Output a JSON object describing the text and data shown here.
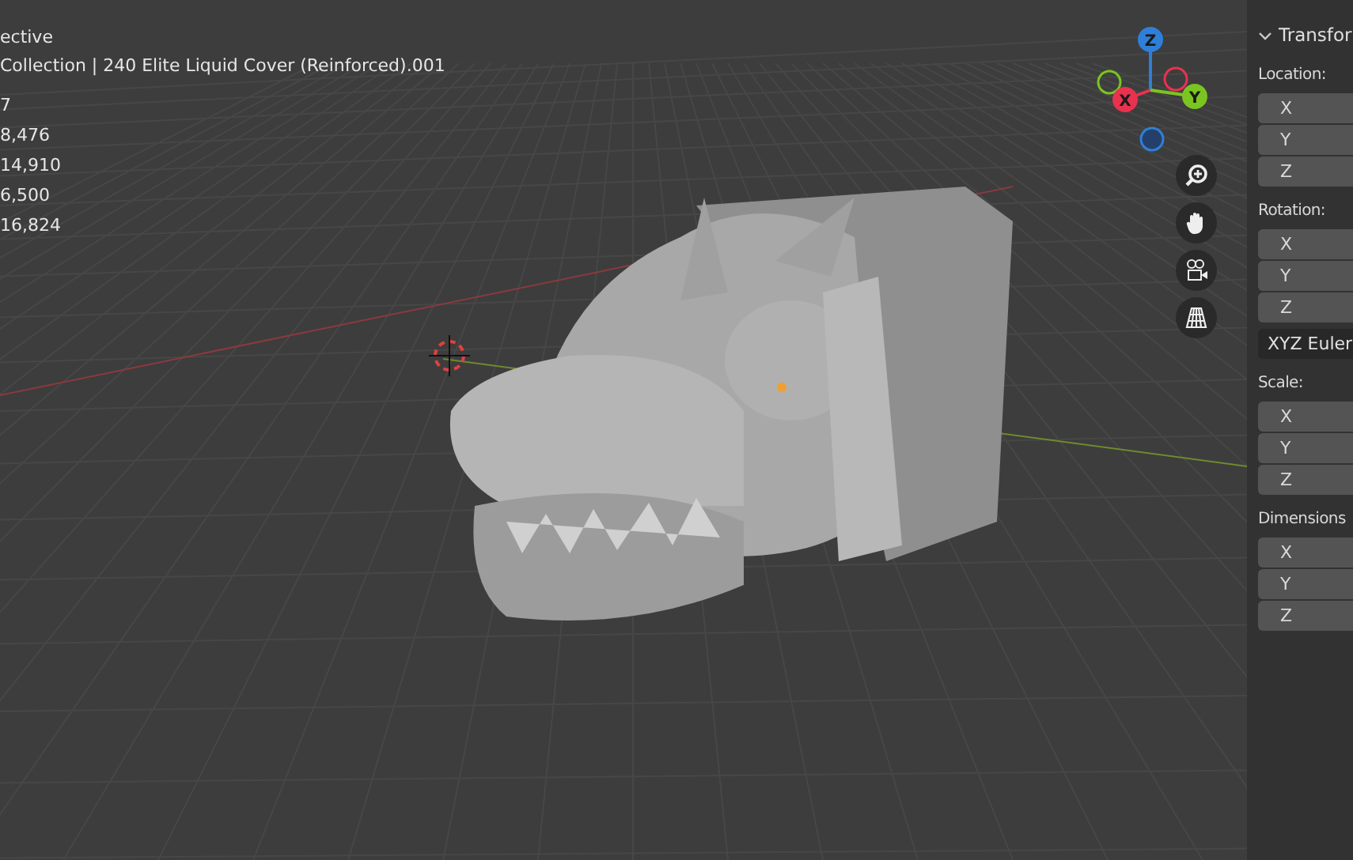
{
  "overlay": {
    "lines": [
      "ective",
      "Collection | 240 Elite Liquid Cover (Reinforced).001"
    ],
    "stats": [
      "7",
      "8,476",
      "14,910",
      "6,500",
      "16,824"
    ]
  },
  "gizmo": {
    "axes": [
      {
        "label": "Z",
        "color": "#2f7fd8"
      },
      {
        "label": "X",
        "color": "#e8324f"
      },
      {
        "label": "Y",
        "color": "#7ac51f"
      }
    ]
  },
  "panel": {
    "title": "Transfor",
    "expanded": true,
    "groups": [
      {
        "label": "Location:",
        "fields": [
          "X",
          "Y",
          "Z"
        ]
      },
      {
        "label": "Rotation:",
        "fields": [
          "X",
          "Y",
          "Z"
        ],
        "mode": "XYZ Euler"
      },
      {
        "label": "Scale:",
        "fields": [
          "X",
          "Y",
          "Z"
        ]
      },
      {
        "label": "Dimensions",
        "fields": [
          "X",
          "Y",
          "Z"
        ]
      }
    ]
  }
}
